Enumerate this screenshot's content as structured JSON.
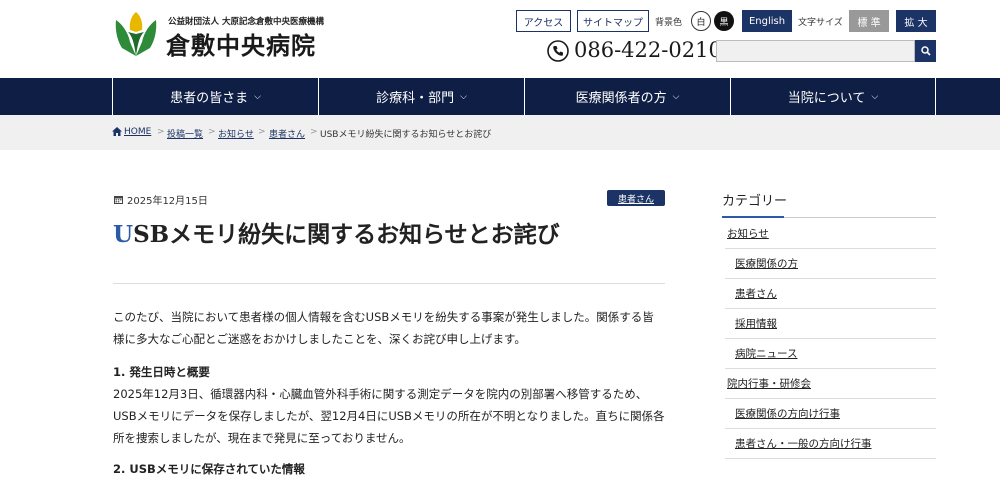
{
  "header": {
    "org_sub": "公益財団法人 大原記念倉敷中央医療機構",
    "org_title": "倉敷中央病院",
    "access_label": "アクセス",
    "sitemap_label": "サイトマップ",
    "bg_color_label": "背景色",
    "bg_white_label": "白",
    "bg_black_label": "黒",
    "english_label": "English",
    "font_size_label": "文字サイズ",
    "standard_label": "標 準",
    "large_label": "拡 大",
    "phone": "086-422-0210",
    "search_placeholder": ""
  },
  "nav": {
    "items": [
      {
        "label": "患者の皆さま"
      },
      {
        "label": "診療科・部門"
      },
      {
        "label": "医療関係者の方"
      },
      {
        "label": "当院について"
      }
    ]
  },
  "breadcrumb": {
    "home": "HOME",
    "items": [
      "投稿一覧",
      "お知らせ",
      "患者さん"
    ],
    "current": "USBメモリ紛失に関するお知らせとお詫び"
  },
  "article": {
    "date": "2025年12月15日",
    "category": "患者さん",
    "title_first": "U",
    "title_rest": "SBメモリ紛失に関するお知らせとお詫び",
    "intro": "このたび、当院において患者様の個人情報を含むUSBメモリを紛失する事案が発生しました。関係する皆様に多大なご心配とご迷惑をおかけしましたことを、深くお詫び申し上げます。",
    "section1_heading": "1. 発生日時と概要",
    "section1_body": "2025年12月3日、循環器内科・心臓血管外科手術に関する測定データを院内の別部署へ移管するため、USBメモリにデータを保存しましたが、翌12月4日にUSBメモリの所在が不明となりました。直ちに関係各所を捜索しましたが、現在まで発見に至っておりません。",
    "section2_heading": "2. USBメモリに保存されていた情報"
  },
  "sidebar": {
    "title": "カテゴリー",
    "items": [
      {
        "label": "お知らせ",
        "indent": false
      },
      {
        "label": "医療関係の方",
        "indent": true
      },
      {
        "label": "患者さん",
        "indent": true
      },
      {
        "label": "採用情報",
        "indent": true
      },
      {
        "label": "病院ニュース",
        "indent": true
      },
      {
        "label": "院内行事・研修会",
        "indent": false
      },
      {
        "label": "医療関係の方向け行事",
        "indent": true
      },
      {
        "label": "患者さん・一般の方向け行事",
        "indent": true
      }
    ]
  },
  "colors": {
    "navy": "#0e1e44",
    "button_navy": "#1c3365",
    "accent_blue": "#2a5aa8",
    "logo_green": "#2e8b3a",
    "logo_yellow": "#e8b800"
  }
}
